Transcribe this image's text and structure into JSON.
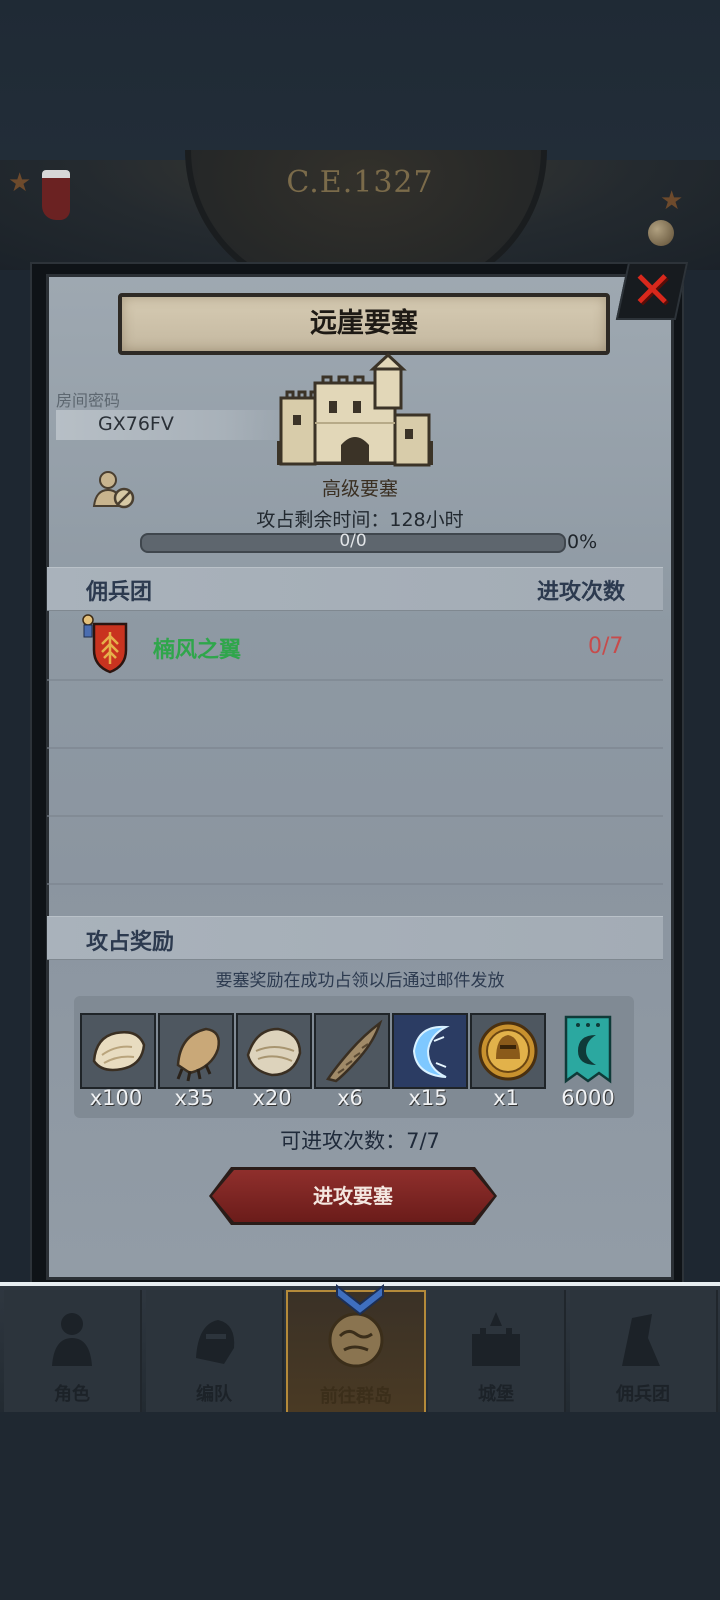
{
  "header": {
    "era": "C.E.1327"
  },
  "dialog": {
    "title": "远崖要塞",
    "close_symbol": "✕",
    "room_label": "房间密码",
    "room_code": "GX76FV",
    "fortress_type": "高级要塞",
    "time_remaining": "攻占剩余时间：128小时",
    "progress": {
      "text": "0/0",
      "percent_text": "0%",
      "fraction": 0.0
    },
    "mercenary_header": "佣兵团",
    "attack_count_header": "进攻次数",
    "guilds": [
      {
        "name": "楠风之翼",
        "attacks": "0/7"
      }
    ],
    "reward_header": "攻占奖励",
    "reward_note": "要塞奖励在成功占领以后通过邮件发放",
    "rewards": [
      {
        "icon": "fur-pelt-icon",
        "qty": "x100"
      },
      {
        "icon": "beast-claw-icon",
        "qty": "x35"
      },
      {
        "icon": "hide-icon",
        "qty": "x20"
      },
      {
        "icon": "horn-icon",
        "qty": "x6"
      },
      {
        "icon": "crescent-crystal-icon",
        "qty": "x15"
      },
      {
        "icon": "knight-medal-icon",
        "qty": "x1"
      },
      {
        "icon": "guild-banner-icon",
        "qty": "6000"
      }
    ],
    "attacks_left": "可进攻次数：7/7",
    "attack_button": "进攻要塞"
  },
  "nav": {
    "items": [
      {
        "label": "角色",
        "icon": "character-icon"
      },
      {
        "label": "编队",
        "icon": "squad-icon"
      },
      {
        "label": "前往群岛",
        "icon": "globe-icon",
        "active": true
      },
      {
        "label": "城堡",
        "icon": "castle-icon"
      },
      {
        "label": "佣兵团",
        "icon": "mercenary-icon"
      }
    ]
  },
  "colors": {
    "accent_green": "#2fa64b",
    "count_red": "#c74b4b",
    "button_red": "#8f2f2c",
    "active_gold": "#b48a3a"
  }
}
